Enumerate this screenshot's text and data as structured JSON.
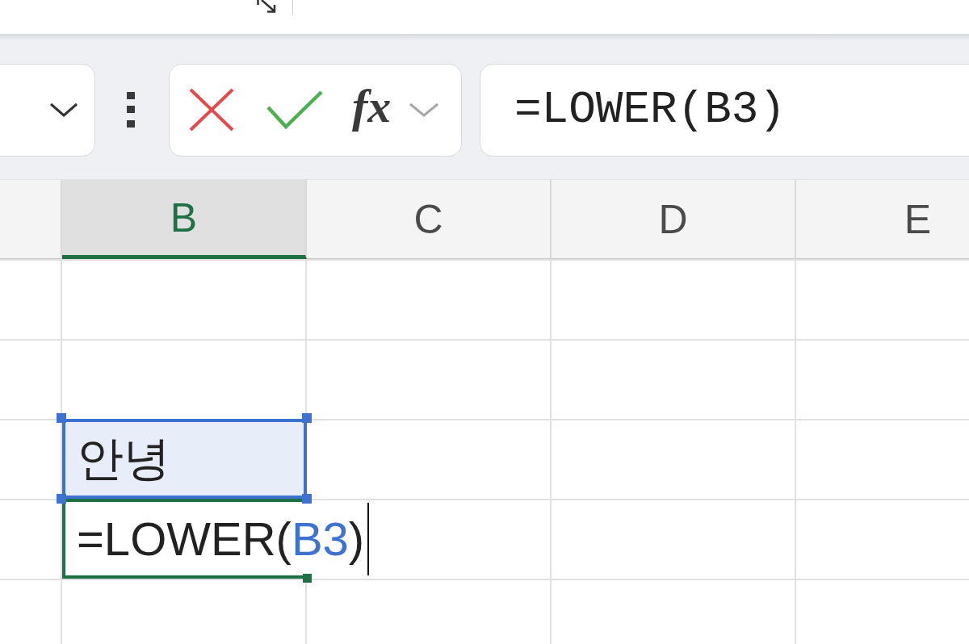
{
  "formula_bar": {
    "function_label": "fx",
    "formula": "=LOWER(B3)"
  },
  "columns": [
    {
      "label": "B",
      "selected": true
    },
    {
      "label": "C",
      "selected": false
    },
    {
      "label": "D",
      "selected": false
    },
    {
      "label": "E",
      "selected": false
    }
  ],
  "rows": [
    {
      "cells": [
        {
          "kind": "empty"
        },
        {
          "kind": "empty"
        },
        {
          "kind": "empty"
        },
        {
          "kind": "empty"
        }
      ]
    },
    {
      "cells": [
        {
          "kind": "empty"
        },
        {
          "kind": "empty"
        },
        {
          "kind": "empty"
        },
        {
          "kind": "empty"
        }
      ]
    },
    {
      "cells": [
        {
          "kind": "reference",
          "value": "안녕",
          "color": "#3d72d1"
        },
        {
          "kind": "empty"
        },
        {
          "kind": "empty"
        },
        {
          "kind": "empty"
        }
      ]
    },
    {
      "cells": [
        {
          "kind": "editing",
          "segments": [
            {
              "text": "=LOWER("
            },
            {
              "text": "B3",
              "color": "#3d72d1"
            },
            {
              "text": ")"
            }
          ]
        },
        {
          "kind": "empty"
        },
        {
          "kind": "empty"
        },
        {
          "kind": "empty"
        }
      ]
    },
    {
      "cells": [
        {
          "kind": "empty"
        },
        {
          "kind": "empty"
        },
        {
          "kind": "empty"
        },
        {
          "kind": "empty"
        }
      ]
    }
  ]
}
